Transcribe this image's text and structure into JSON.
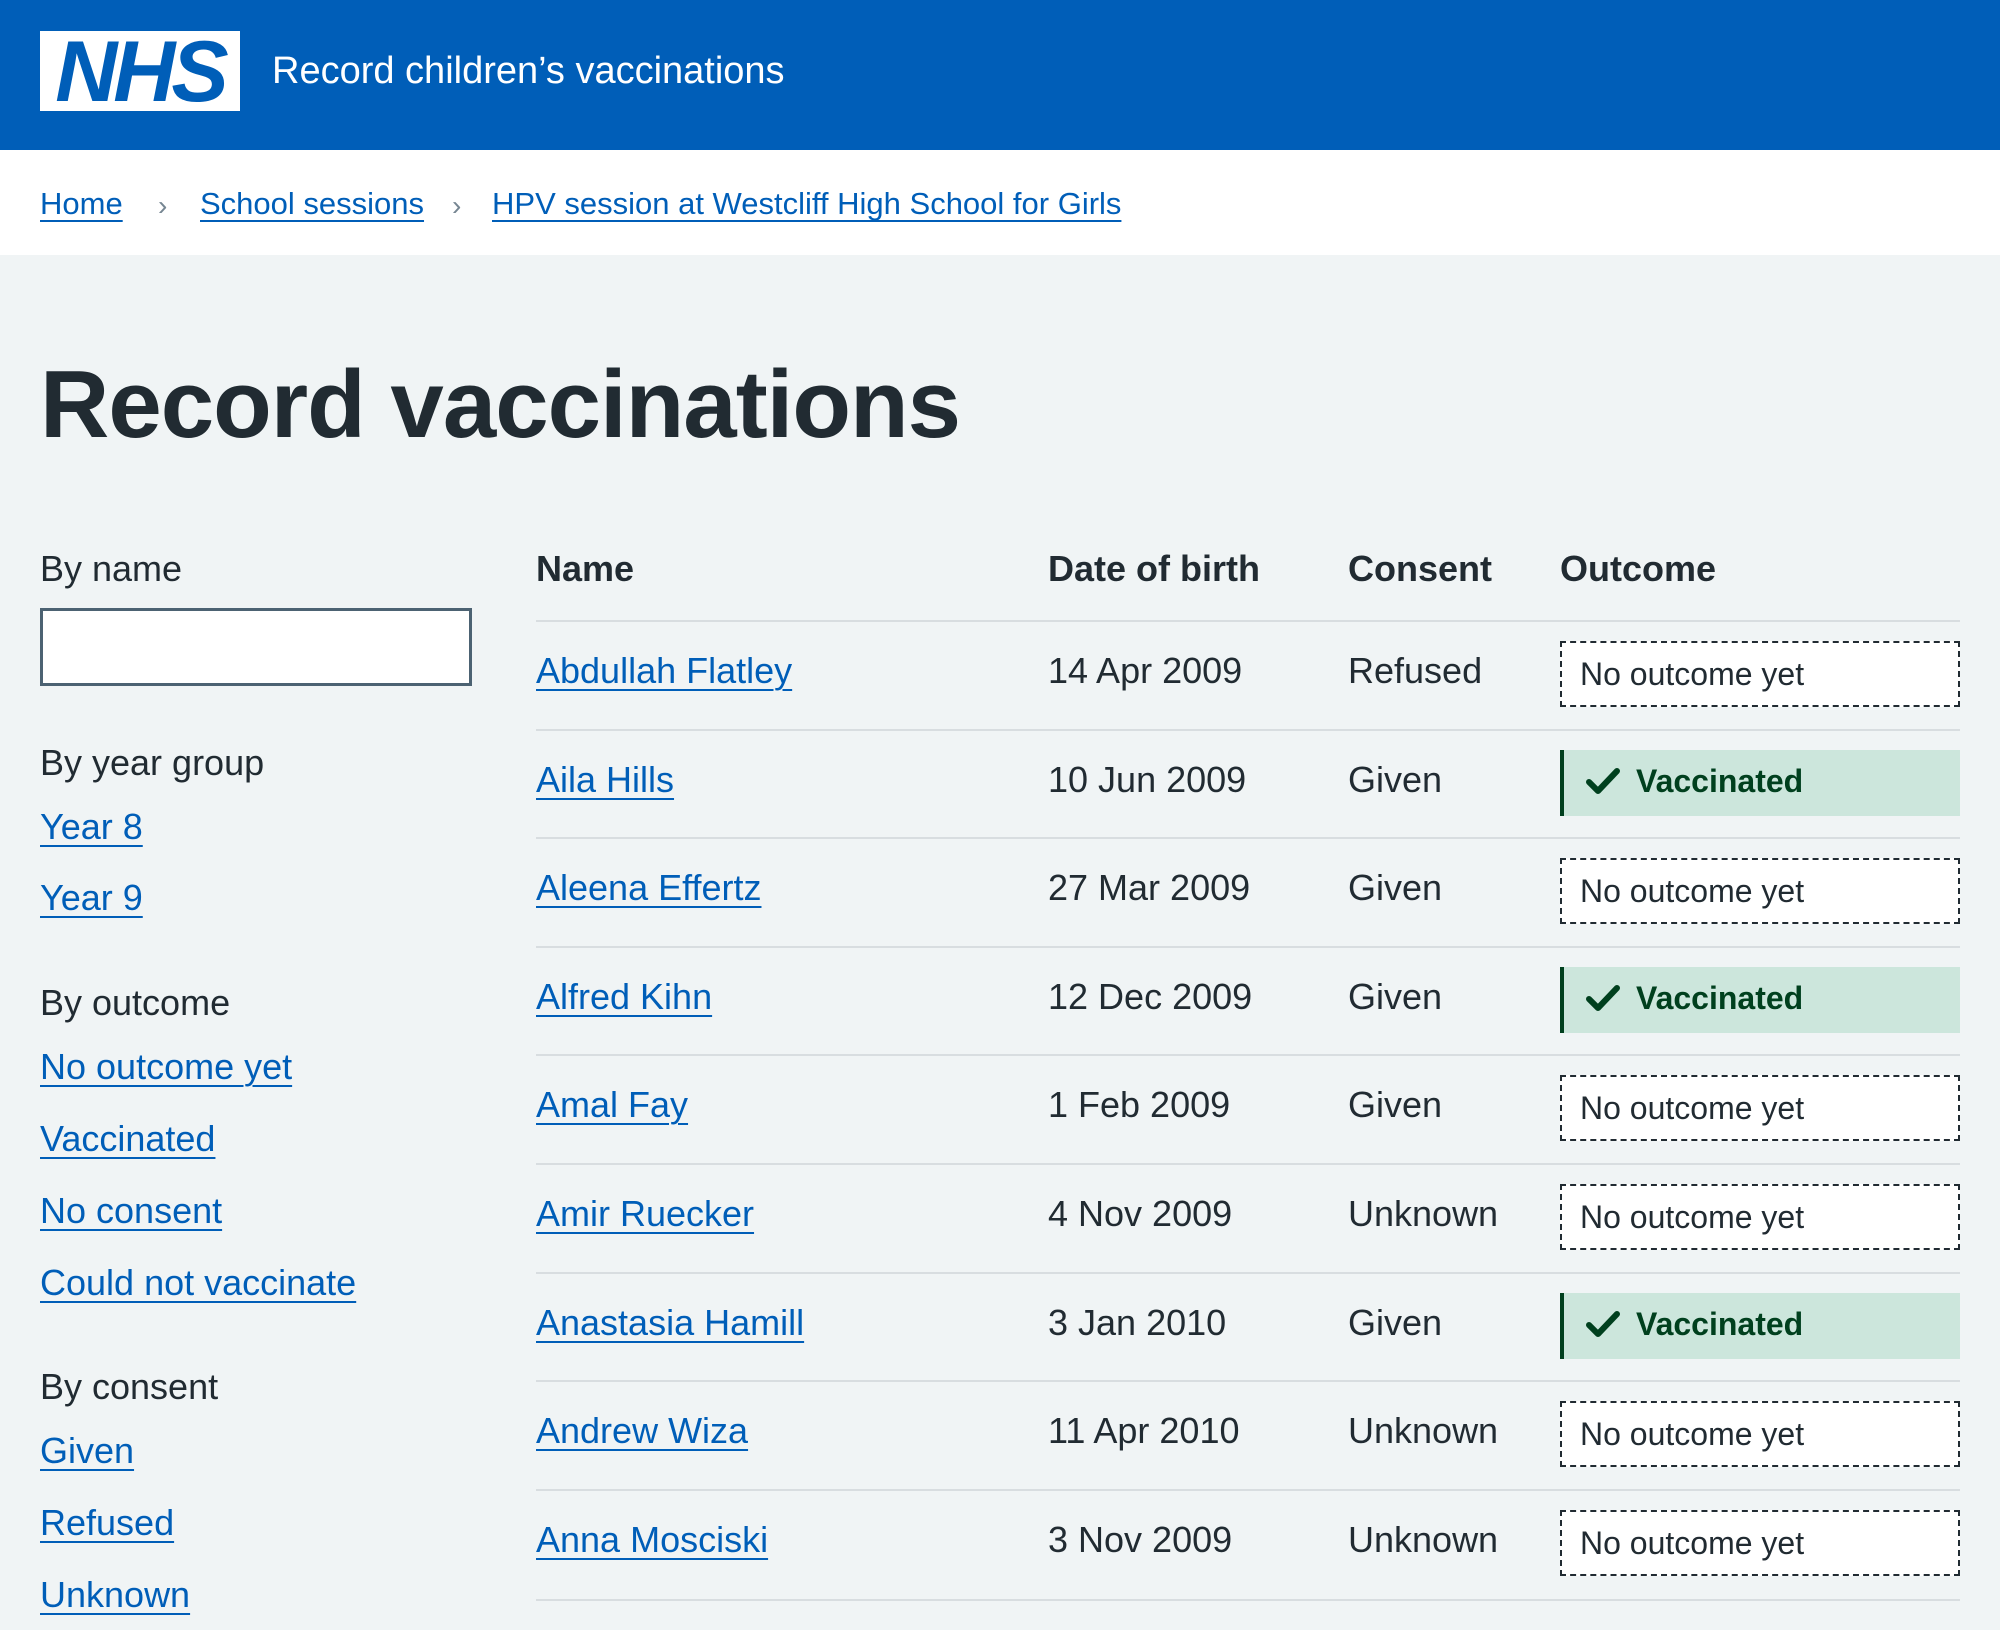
{
  "header": {
    "logo": "NHS",
    "service_name": "Record children’s vaccinations"
  },
  "breadcrumbs": [
    {
      "label": "Home"
    },
    {
      "label": "School sessions"
    },
    {
      "label": "HPV session at Westcliff High School for Girls"
    }
  ],
  "page_title": "Record vaccinations",
  "filters": {
    "by_name": {
      "heading": "By name",
      "value": "",
      "placeholder": ""
    },
    "by_year_group": {
      "heading": "By year group",
      "options": [
        "Year 8",
        "Year 9"
      ]
    },
    "by_outcome": {
      "heading": "By outcome",
      "options": [
        "No outcome yet",
        "Vaccinated",
        "No consent",
        "Could not vaccinate"
      ]
    },
    "by_consent": {
      "heading": "By consent",
      "options": [
        "Given",
        "Refused",
        "Unknown"
      ]
    }
  },
  "table": {
    "columns": [
      "Name",
      "Date of birth",
      "Consent",
      "Outcome"
    ],
    "rows": [
      {
        "name": "Abdullah Flatley",
        "dob": "14 Apr 2009",
        "consent": "Refused",
        "outcome": "No outcome yet"
      },
      {
        "name": "Aila Hills",
        "dob": "10 Jun 2009",
        "consent": "Given",
        "outcome": "Vaccinated"
      },
      {
        "name": "Aleena Effertz",
        "dob": "27 Mar 2009",
        "consent": "Given",
        "outcome": "No outcome yet"
      },
      {
        "name": "Alfred Kihn",
        "dob": "12 Dec 2009",
        "consent": "Given",
        "outcome": "Vaccinated"
      },
      {
        "name": "Amal Fay",
        "dob": "1 Feb 2009",
        "consent": "Given",
        "outcome": "No outcome yet"
      },
      {
        "name": "Amir Ruecker",
        "dob": "4 Nov 2009",
        "consent": "Unknown",
        "outcome": "No outcome yet"
      },
      {
        "name": "Anastasia Hamill",
        "dob": "3 Jan 2010",
        "consent": "Given",
        "outcome": "Vaccinated"
      },
      {
        "name": "Andrew Wiza",
        "dob": "11 Apr 2010",
        "consent": "Unknown",
        "outcome": "No outcome yet"
      },
      {
        "name": "Anna Mosciski",
        "dob": "3 Nov 2009",
        "consent": "Unknown",
        "outcome": "No outcome yet"
      }
    ]
  },
  "colors": {
    "header_blue": "#005eb8",
    "link_blue": "#005eb8",
    "page_background": "#f0f4f5",
    "text": "#212b32",
    "vaccinated_background": "#cce6dc",
    "vaccinated_text": "#00401e"
  },
  "icons": {
    "breadcrumb_separator": "chevron-right-icon",
    "vaccinated_tag": "tick-icon"
  }
}
